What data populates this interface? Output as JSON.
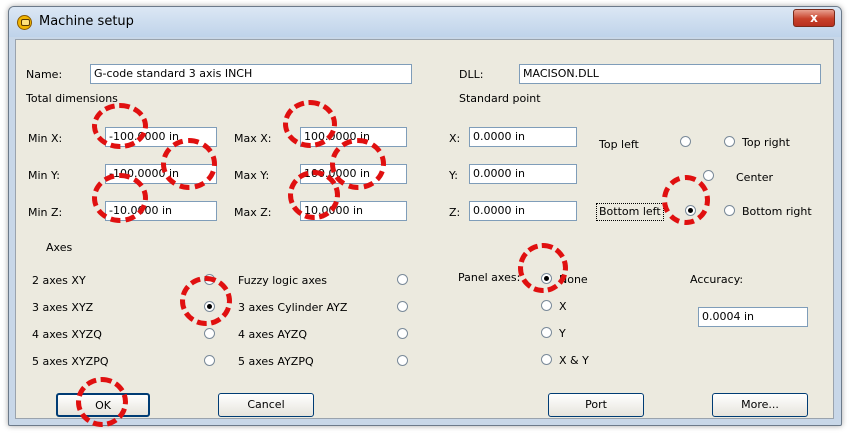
{
  "window": {
    "title": "Machine setup",
    "close_glyph": "x"
  },
  "name": {
    "label": "Name:",
    "value": "G-code standard 3 axis INCH"
  },
  "dll": {
    "label": "DLL:",
    "value": "MACISON.DLL"
  },
  "total_dimensions": {
    "heading": "Total dimensions",
    "min_x": {
      "label": "Min X:",
      "value": "-100.0000 in"
    },
    "min_y": {
      "label": "Min Y:",
      "value": "-100.0000 in"
    },
    "min_z": {
      "label": "Min Z:",
      "value": "-10.0000 in"
    },
    "max_x": {
      "label": "Max X:",
      "value": "100.0000 in"
    },
    "max_y": {
      "label": "Max Y:",
      "value": "100.0000 in"
    },
    "max_z": {
      "label": "Max Z:",
      "value": "10.0000 in"
    }
  },
  "standard_point": {
    "heading": "Standard point",
    "x": {
      "label": "X:",
      "value": "0.0000 in"
    },
    "y": {
      "label": "Y:",
      "value": "0.0000 in"
    },
    "z": {
      "label": "Z:",
      "value": "0.0000 in"
    },
    "options": {
      "top_left": "Top left",
      "top_right": "Top right",
      "center": "Center",
      "bottom_left": "Bottom left",
      "bottom_right": "Bottom right"
    },
    "selected": "Bottom left"
  },
  "axes": {
    "heading": "Axes",
    "options": {
      "xy": "2 axes XY",
      "xyz": "3 axes XYZ",
      "xyzq": "4 axes XYZQ",
      "xyzpq": "5 axes XYZPQ",
      "fuzzy": "Fuzzy logic axes",
      "cyl_ayz": "3 axes Cylinder AYZ",
      "ayzq": "4 axes AYZQ",
      "ayzpq": "5 axes AYZPQ"
    },
    "selected": "3 axes XYZ"
  },
  "panel_axes": {
    "label": "Panel axes:",
    "options": {
      "none": "None",
      "x": "X",
      "y": "Y",
      "xy": "X & Y"
    },
    "selected": "None"
  },
  "accuracy": {
    "label": "Accuracy:",
    "value": "0.0004 in"
  },
  "buttons": {
    "ok": "OK",
    "cancel": "Cancel",
    "port": "Port",
    "more": "More..."
  },
  "colors": {
    "highlight": "#e01010",
    "dialog_bg": "#eceadf",
    "titlebar": "#c8d7e8"
  }
}
